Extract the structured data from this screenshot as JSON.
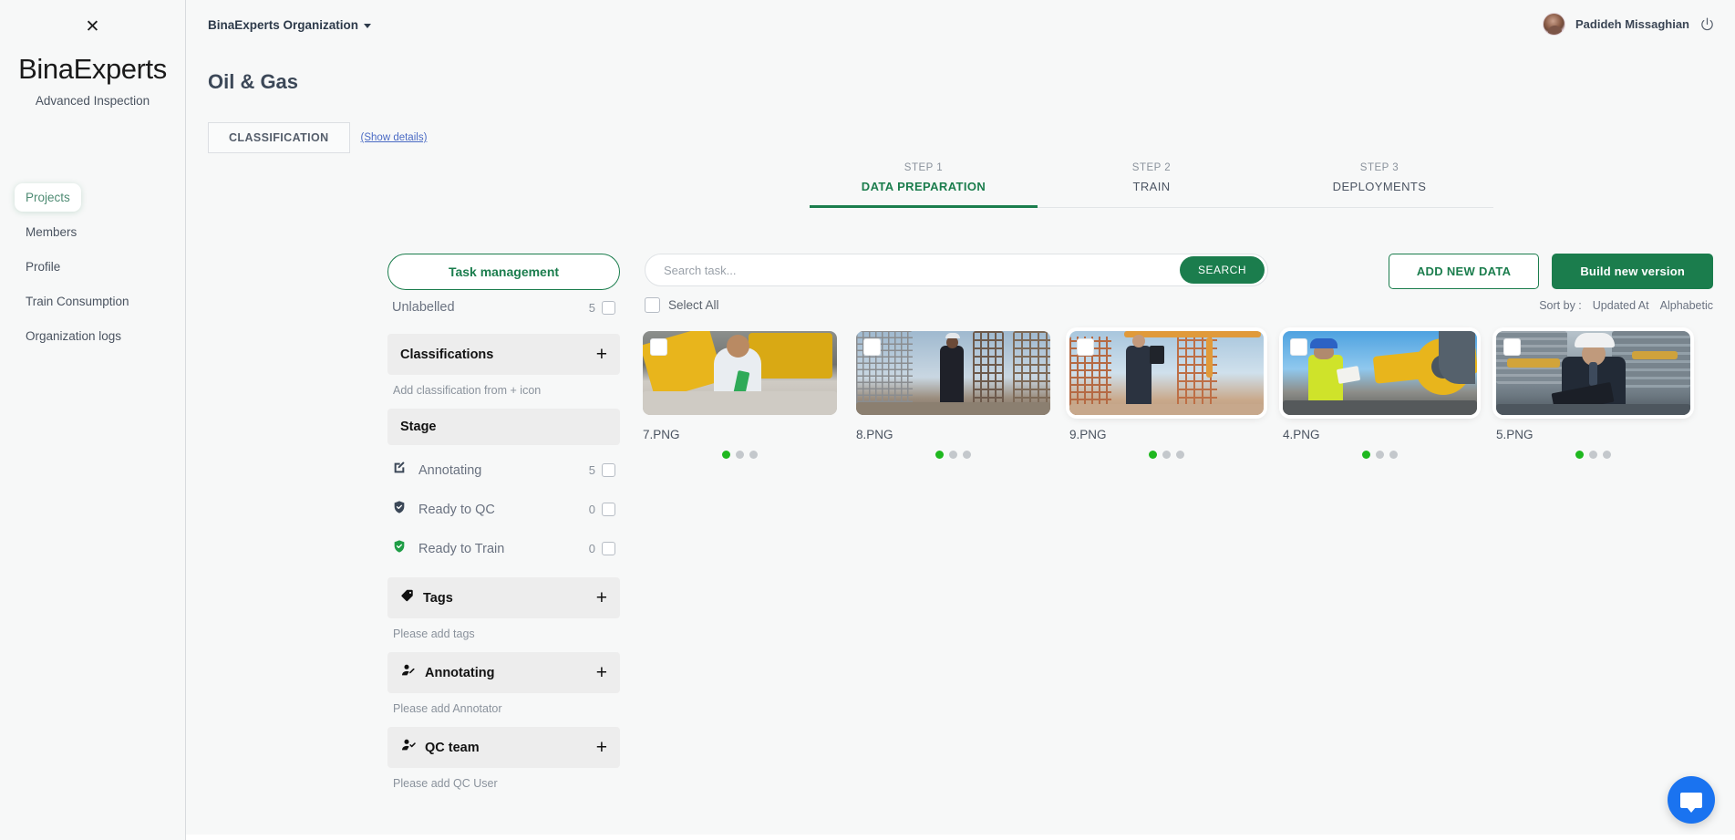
{
  "sidebar": {
    "close_icon": "close-icon",
    "brand": "BinaExperts",
    "tagline": "Advanced Inspection",
    "items": [
      {
        "label": "Projects",
        "active": true
      },
      {
        "label": "Members",
        "active": false
      },
      {
        "label": "Profile",
        "active": false
      },
      {
        "label": "Train Consumption",
        "active": false
      },
      {
        "label": "Organization logs",
        "active": false
      }
    ]
  },
  "topbar": {
    "organization": "BinaExperts Organization",
    "user_name": "Padideh Missaghian",
    "power_icon": "power-icon",
    "avatar": "avatar"
  },
  "header": {
    "page_title": "Oil & Gas",
    "classification_badge": "CLASSIFICATION",
    "show_details": "(Show details)"
  },
  "steps": [
    {
      "num": "STEP 1",
      "label": "DATA PREPARATION",
      "active": true
    },
    {
      "num": "STEP 2",
      "label": "TRAIN",
      "active": false
    },
    {
      "num": "STEP 3",
      "label": "DEPLOYMENTS",
      "active": false
    }
  ],
  "filters": {
    "task_management": "Task management",
    "unlabelled": {
      "label": "Unlabelled",
      "count": "5"
    },
    "classifications": {
      "title": "Classifications",
      "add": "+",
      "hint": "Add classification from + icon"
    },
    "stage": {
      "title": "Stage",
      "rows": [
        {
          "icon": "pencil-square-icon",
          "label": "Annotating",
          "count": "5"
        },
        {
          "icon": "shield-check-icon",
          "label": "Ready to QC",
          "count": "0"
        },
        {
          "icon": "shield-check-green-icon",
          "label": "Ready to Train",
          "count": "0"
        }
      ]
    },
    "tags": {
      "icon": "tag-icon",
      "title": "Tags",
      "add": "+",
      "hint": "Please add tags"
    },
    "annotating": {
      "icon": "user-edit-icon",
      "title": "Annotating",
      "add": "+",
      "hint": "Please add Annotator"
    },
    "qc_team": {
      "icon": "user-check-icon",
      "title": "QC team",
      "add": "+",
      "hint": "Please add QC User"
    }
  },
  "search": {
    "placeholder": "Search task...",
    "value": "",
    "button": "SEARCH",
    "select_all": "Select All"
  },
  "actions": {
    "add_new_data": "ADD NEW DATA",
    "build_new_version": "Build new version",
    "sort_by_label": "Sort by :",
    "sort_options": [
      "Updated At",
      "Alphabetic"
    ]
  },
  "cards": [
    {
      "name": "7.PNG",
      "selected": false,
      "dots": [
        true,
        false,
        false
      ],
      "art": "t1"
    },
    {
      "name": "8.PNG",
      "selected": false,
      "dots": [
        true,
        false,
        false
      ],
      "art": "t2"
    },
    {
      "name": "9.PNG",
      "selected": true,
      "dots": [
        true,
        false,
        false
      ],
      "art": "t3"
    },
    {
      "name": "4.PNG",
      "selected": true,
      "dots": [
        true,
        false,
        false
      ],
      "art": "t4"
    },
    {
      "name": "5.PNG",
      "selected": true,
      "dots": [
        true,
        false,
        false
      ],
      "art": "t5"
    }
  ],
  "chat": {
    "icon": "chat-bubble-icon"
  },
  "colors": {
    "accent_green": "#1b7d4d",
    "dot_green": "#1fb81f",
    "chat_blue": "#1a73f0",
    "link_blue": "#4b6bc4",
    "page_bg": "#f7f8f8",
    "section_bg": "#ededed"
  }
}
